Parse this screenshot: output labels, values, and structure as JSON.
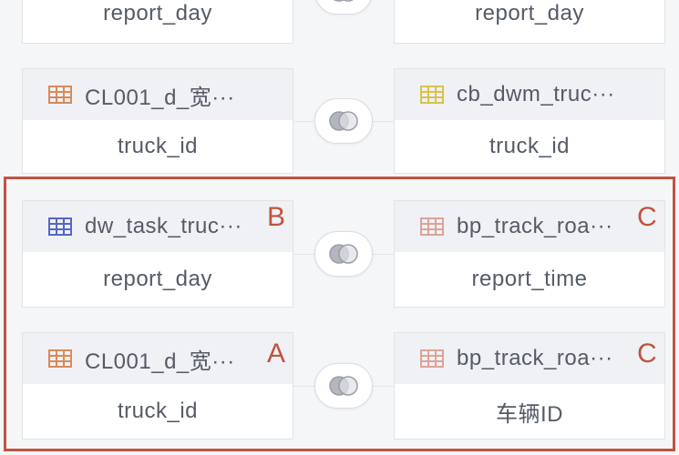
{
  "colors": {
    "accent_highlight": "#c0533f",
    "icon_orange": "#d98a5a",
    "icon_yellow": "#d9c24a",
    "icon_blue": "#5566c8",
    "icon_pink": "#dba39a"
  },
  "joins": [
    {
      "left": {
        "table": "",
        "field": "report_day",
        "icon": "table-icon"
      },
      "right": {
        "table": "",
        "field": "report_day",
        "icon": "table-icon"
      },
      "join_icon": "join-venn-icon"
    },
    {
      "left": {
        "table": "CL001_d_宽···",
        "field": "truck_id",
        "icon": "table-icon",
        "icon_color": "orange"
      },
      "right": {
        "table": "cb_dwm_truc···",
        "field": "truck_id",
        "icon": "table-icon",
        "icon_color": "yellow"
      },
      "join_icon": "join-venn-icon"
    },
    {
      "left": {
        "table": "dw_task_truc···",
        "field": "report_day",
        "icon": "table-icon",
        "icon_color": "blue",
        "marker": "B"
      },
      "right": {
        "table": "bp_track_roa···",
        "field": "report_time",
        "icon": "table-icon",
        "icon_color": "pink",
        "marker": "C"
      },
      "join_icon": "join-venn-icon"
    },
    {
      "left": {
        "table": "CL001_d_宽···",
        "field": "truck_id",
        "icon": "table-icon",
        "icon_color": "orange",
        "marker": "A"
      },
      "right": {
        "table": "bp_track_roa···",
        "field": "车辆ID",
        "icon": "table-icon",
        "icon_color": "pink",
        "marker": "C"
      },
      "join_icon": "join-venn-icon"
    }
  ]
}
